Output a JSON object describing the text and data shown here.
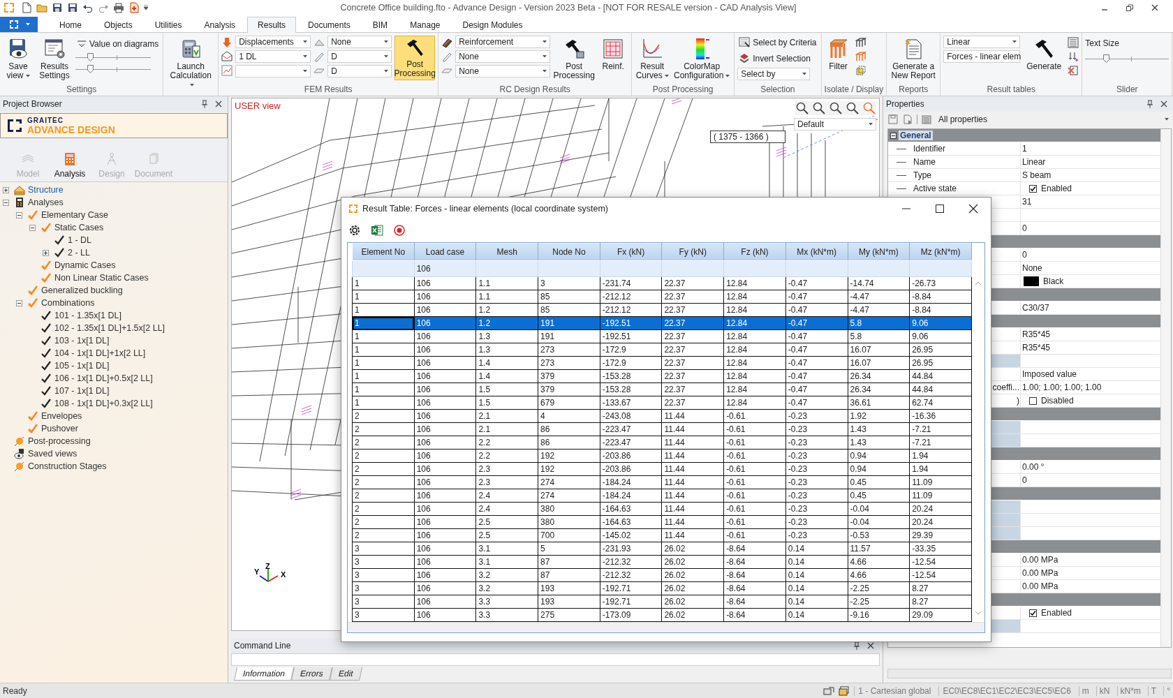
{
  "title_bar": {
    "title": "Concrete Office building.fto - Advance Design - Version 2023 Beta - [NOT FOR RESALE version - CAD Analysis View]"
  },
  "ribbon_tabs": [
    {
      "label": "Home",
      "selected": false
    },
    {
      "label": "Objects",
      "selected": false
    },
    {
      "label": "Utilities",
      "selected": false
    },
    {
      "label": "Analysis",
      "selected": false
    },
    {
      "label": "Results",
      "selected": true
    },
    {
      "label": "Documents",
      "selected": false
    },
    {
      "label": "BIM",
      "selected": false
    },
    {
      "label": "Manage",
      "selected": false
    },
    {
      "label": "Design Modules",
      "selected": false
    }
  ],
  "ribbon": {
    "settings": {
      "label": "Settings",
      "buttons": [
        "Save view",
        "Results Settings"
      ],
      "value_option": "Value on diagrams",
      "sliders": [
        {
          "level": 0.19
        },
        {
          "level": 0.19
        }
      ]
    },
    "calculation": {
      "button": "Launch Calculation"
    },
    "fem_results": {
      "label": "FEM Results",
      "combos_left": [
        {
          "value": "Displacements"
        },
        {
          "value": "1 DL"
        }
      ],
      "combos_right": [
        {
          "value": "None"
        },
        {
          "value": "D"
        },
        {
          "value": "D"
        }
      ],
      "button": "Post Processing",
      "active": true
    },
    "rc_design": {
      "label": "RC Design Results",
      "combos": [
        {
          "value": "Reinforcement"
        },
        {
          "value": "None"
        },
        {
          "value": "None"
        }
      ],
      "buttons": [
        "Post Processing",
        "Reinf."
      ]
    },
    "post_processing": {
      "label": "Post Processing",
      "buttons": [
        "Result Curves",
        "ColorMap Configuration"
      ]
    },
    "selection": {
      "label": "Selection",
      "actions": [
        "Select by Criteria",
        "Invert Selection"
      ],
      "combo": {
        "value": "Select by"
      }
    },
    "isolate": {
      "label": "Isolate / Display",
      "button": "Filter"
    },
    "reports": {
      "label": "Reports",
      "button": "Generate a New Report"
    },
    "result_tables": {
      "label": "Result tables",
      "combos": [
        {
          "value": "Linear"
        },
        {
          "value": "Forces - linear elem"
        }
      ],
      "button": "Generate"
    },
    "slider_group": {
      "label": "Slider",
      "caption": "Text Size",
      "slider": {
        "level": 0.25
      }
    }
  },
  "project_browser": {
    "title": "Project Browser",
    "brand": "GRAITEC",
    "product": "ADVANCE DESIGN",
    "tabs": [
      {
        "label": "Model",
        "selected": false
      },
      {
        "label": "Analysis",
        "selected": true
      },
      {
        "label": "Design",
        "selected": false
      },
      {
        "label": "Document",
        "selected": false
      }
    ],
    "tree": [
      {
        "label": "Structure",
        "kind": "structure",
        "expanded": false
      },
      {
        "label": "Analyses",
        "kind": "calculator",
        "expanded": true,
        "children": [
          {
            "label": "Elementary Case",
            "kind": "case",
            "expanded": true,
            "children": [
              {
                "label": "Static Cases",
                "kind": "case",
                "expanded": true,
                "children": [
                  {
                    "label": "1 - DL",
                    "kind": "load"
                  },
                  {
                    "label": "2 - LL",
                    "kind": "load",
                    "expanded": false
                  }
                ]
              },
              {
                "label": "Dynamic Cases",
                "kind": "case"
              },
              {
                "label": "Non Linear Static Cases",
                "kind": "case"
              }
            ]
          },
          {
            "label": "Generalized buckling",
            "kind": "case"
          },
          {
            "label": "Combinations",
            "kind": "case",
            "expanded": true,
            "children": [
              {
                "label": "101 - 1.35x[1 DL]",
                "kind": "load"
              },
              {
                "label": "102 - 1.35x[1 DL]+1.5x[2 LL]",
                "kind": "load"
              },
              {
                "label": "103 - 1x[1 DL]",
                "kind": "load"
              },
              {
                "label": "104 - 1x[1 DL]+1x[2 LL]",
                "kind": "load"
              },
              {
                "label": "105 - 1x[1 DL]",
                "kind": "load"
              },
              {
                "label": "106 - 1x[1 DL]+0.5x[2 LL]",
                "kind": "load"
              },
              {
                "label": "107 - 1x[1 DL]",
                "kind": "load"
              },
              {
                "label": "108 - 1x[1 DL]+0.3x[2 LL]",
                "kind": "load"
              }
            ]
          },
          {
            "label": "Envelopes",
            "kind": "case"
          },
          {
            "label": "Pushover",
            "kind": "case"
          }
        ]
      },
      {
        "label": "Post-processing",
        "kind": "process"
      },
      {
        "label": "Saved views",
        "kind": "views"
      },
      {
        "label": "Construction Stages",
        "kind": "process"
      }
    ]
  },
  "viewport": {
    "title": "USER view",
    "view_preset": "Default",
    "coordinates": "( 1375 - 1366 )",
    "axes": [
      "Y",
      "Z",
      "X"
    ]
  },
  "command_line": {
    "title": "Command Line",
    "tabs": [
      {
        "label": "Information",
        "selected": true
      },
      {
        "label": "Errors",
        "selected": false
      },
      {
        "label": "Edit",
        "selected": false
      }
    ]
  },
  "properties": {
    "title": "Properties",
    "filter": "All properties",
    "rows": [
      {
        "kind": "header",
        "label": "General",
        "expanded": true
      },
      {
        "kind": "field",
        "label": "Identifier",
        "value": "1"
      },
      {
        "kind": "field",
        "label": "Name",
        "value": "Linear"
      },
      {
        "kind": "field",
        "label": "Type",
        "value": "S beam"
      },
      {
        "kind": "check",
        "label": "Active state",
        "value": "Enabled",
        "checked": true
      },
      {
        "kind": "field",
        "value": "31"
      },
      {
        "kind": "blank"
      },
      {
        "kind": "field",
        "value": "0"
      },
      {
        "kind": "header"
      },
      {
        "kind": "field",
        "value": "0"
      },
      {
        "kind": "field",
        "value": "None"
      },
      {
        "kind": "color",
        "value": "Black",
        "color": "#000000"
      },
      {
        "kind": "header"
      },
      {
        "kind": "field",
        "value": "C30/37"
      },
      {
        "kind": "header"
      },
      {
        "kind": "field",
        "value": "R35*45"
      },
      {
        "kind": "field",
        "value": "R35*45"
      },
      {
        "kind": "shaded"
      },
      {
        "kind": "field",
        "value": "Imposed value"
      },
      {
        "kind": "field",
        "label": "coeffi...",
        "value": "1.00; 1.00; 1.00; 1.00"
      },
      {
        "kind": "check",
        "label": ")",
        "value": "Disabled",
        "checked": false
      },
      {
        "kind": "header"
      },
      {
        "kind": "shaded"
      },
      {
        "kind": "shaded"
      },
      {
        "kind": "header"
      },
      {
        "kind": "field",
        "value": "0.00 °"
      },
      {
        "kind": "field",
        "value": "0"
      },
      {
        "kind": "header"
      },
      {
        "kind": "shaded"
      },
      {
        "kind": "shaded"
      },
      {
        "kind": "shaded"
      },
      {
        "kind": "header"
      },
      {
        "kind": "field",
        "value": "0.00 MPa"
      },
      {
        "kind": "field",
        "value": "0.00 MPa"
      },
      {
        "kind": "field",
        "value": "0.00 MPa"
      },
      {
        "kind": "header"
      },
      {
        "kind": "check",
        "value": "Enabled",
        "checked": true
      },
      {
        "kind": "shaded"
      }
    ]
  },
  "result_table": {
    "title": "Result Table: Forces - linear elements (local coordinate system)",
    "columns": [
      "Element No",
      "Load case",
      "Mesh",
      "Node No",
      "Fx (kN)",
      "Fy (kN)",
      "Fz (kN)",
      "Mx (kN*m)",
      "My (kN*m)",
      "Mz (kN*m)"
    ],
    "filter_row": {
      "load_case": "106"
    },
    "rows": [
      {
        "cells": [
          "1",
          "106",
          "1.1",
          "3",
          "-231.74",
          "22.37",
          "12.84",
          "-0.47",
          "-14.74",
          "-26.73"
        ],
        "selected": false
      },
      {
        "cells": [
          "1",
          "106",
          "1.1",
          "85",
          "-212.12",
          "22.37",
          "12.84",
          "-0.47",
          "-4.47",
          "-8.84"
        ],
        "selected": false
      },
      {
        "cells": [
          "1",
          "106",
          "1.2",
          "85",
          "-212.12",
          "22.37",
          "12.84",
          "-0.47",
          "-4.47",
          "-8.84"
        ],
        "selected": false
      },
      {
        "cells": [
          "1",
          "106",
          "1.2",
          "191",
          "-192.51",
          "22.37",
          "12.84",
          "-0.47",
          "5.8",
          "9.06"
        ],
        "selected": true
      },
      {
        "cells": [
          "1",
          "106",
          "1.3",
          "191",
          "-192.51",
          "22.37",
          "12.84",
          "-0.47",
          "5.8",
          "9.06"
        ],
        "selected": false
      },
      {
        "cells": [
          "1",
          "106",
          "1.3",
          "273",
          "-172.9",
          "22.37",
          "12.84",
          "-0.47",
          "16.07",
          "26.95"
        ],
        "selected": false
      },
      {
        "cells": [
          "1",
          "106",
          "1.4",
          "273",
          "-172.9",
          "22.37",
          "12.84",
          "-0.47",
          "16.07",
          "26.95"
        ],
        "selected": false
      },
      {
        "cells": [
          "1",
          "106",
          "1.4",
          "379",
          "-153.28",
          "22.37",
          "12.84",
          "-0.47",
          "26.34",
          "44.84"
        ],
        "selected": false
      },
      {
        "cells": [
          "1",
          "106",
          "1.5",
          "379",
          "-153.28",
          "22.37",
          "12.84",
          "-0.47",
          "26.34",
          "44.84"
        ],
        "selected": false
      },
      {
        "cells": [
          "1",
          "106",
          "1.5",
          "679",
          "-133.67",
          "22.37",
          "12.84",
          "-0.47",
          "36.61",
          "62.74"
        ],
        "selected": false
      },
      {
        "cells": [
          "2",
          "106",
          "2.1",
          "4",
          "-243.08",
          "11.44",
          "-0.61",
          "-0.23",
          "1.92",
          "-16.36"
        ],
        "selected": false
      },
      {
        "cells": [
          "2",
          "106",
          "2.1",
          "86",
          "-223.47",
          "11.44",
          "-0.61",
          "-0.23",
          "1.43",
          "-7.21"
        ],
        "selected": false
      },
      {
        "cells": [
          "2",
          "106",
          "2.2",
          "86",
          "-223.47",
          "11.44",
          "-0.61",
          "-0.23",
          "1.43",
          "-7.21"
        ],
        "selected": false
      },
      {
        "cells": [
          "2",
          "106",
          "2.2",
          "192",
          "-203.86",
          "11.44",
          "-0.61",
          "-0.23",
          "0.94",
          "1.94"
        ],
        "selected": false
      },
      {
        "cells": [
          "2",
          "106",
          "2.3",
          "192",
          "-203.86",
          "11.44",
          "-0.61",
          "-0.23",
          "0.94",
          "1.94"
        ],
        "selected": false
      },
      {
        "cells": [
          "2",
          "106",
          "2.3",
          "274",
          "-184.24",
          "11.44",
          "-0.61",
          "-0.23",
          "0.45",
          "11.09"
        ],
        "selected": false
      },
      {
        "cells": [
          "2",
          "106",
          "2.4",
          "274",
          "-184.24",
          "11.44",
          "-0.61",
          "-0.23",
          "0.45",
          "11.09"
        ],
        "selected": false
      },
      {
        "cells": [
          "2",
          "106",
          "2.4",
          "380",
          "-164.63",
          "11.44",
          "-0.61",
          "-0.23",
          "-0.04",
          "20.24"
        ],
        "selected": false
      },
      {
        "cells": [
          "2",
          "106",
          "2.5",
          "380",
          "-164.63",
          "11.44",
          "-0.61",
          "-0.23",
          "-0.04",
          "20.24"
        ],
        "selected": false
      },
      {
        "cells": [
          "2",
          "106",
          "2.5",
          "700",
          "-145.02",
          "11.44",
          "-0.61",
          "-0.23",
          "-0.53",
          "29.39"
        ],
        "selected": false
      },
      {
        "cells": [
          "3",
          "106",
          "3.1",
          "5",
          "-231.93",
          "26.02",
          "-8.64",
          "0.14",
          "11.57",
          "-33.35"
        ],
        "selected": false
      },
      {
        "cells": [
          "3",
          "106",
          "3.1",
          "87",
          "-212.32",
          "26.02",
          "-8.64",
          "0.14",
          "4.66",
          "-12.54"
        ],
        "selected": false
      },
      {
        "cells": [
          "3",
          "106",
          "3.2",
          "87",
          "-212.32",
          "26.02",
          "-8.64",
          "0.14",
          "4.66",
          "-12.54"
        ],
        "selected": false
      },
      {
        "cells": [
          "3",
          "106",
          "3.2",
          "193",
          "-192.71",
          "26.02",
          "-8.64",
          "0.14",
          "-2.25",
          "8.27"
        ],
        "selected": false
      },
      {
        "cells": [
          "3",
          "106",
          "3.3",
          "193",
          "-192.71",
          "26.02",
          "-8.64",
          "0.14",
          "-2.25",
          "8.27"
        ],
        "selected": false
      },
      {
        "cells": [
          "3",
          "106",
          "3.3",
          "275",
          "-173.09",
          "26.02",
          "-8.64",
          "0.14",
          "-9.16",
          "29.09"
        ],
        "selected": false
      }
    ]
  },
  "status_bar": {
    "status": "Ready",
    "coordinate_system": "1 - Cartesian global",
    "codes": "EC0\\EC8\\EC1\\EC2\\EC3\\EC5\\EC6",
    "units": [
      "m",
      "kN",
      "kN*m",
      "T",
      "°"
    ]
  }
}
